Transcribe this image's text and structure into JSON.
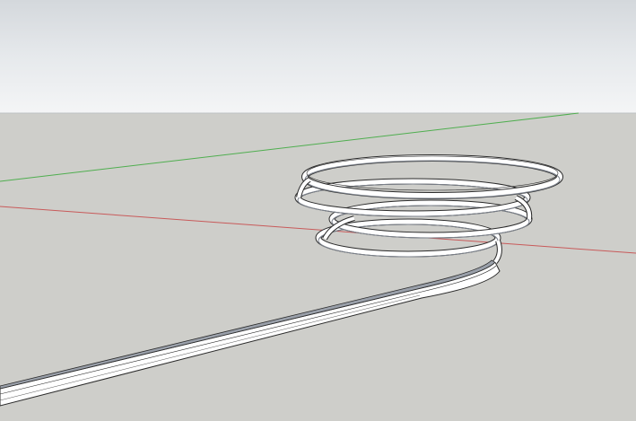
{
  "app": {
    "kind": "3d-modeling-viewport"
  },
  "scene": {
    "sky_color_top": "#d4d8dc",
    "sky_color_bottom": "#f4f5f6",
    "ground_color": "#cececa",
    "axes": {
      "red_axis_color": "#c85a5a",
      "green_axis_color": "#4fae4f"
    },
    "model": {
      "type": "spiral-ramp",
      "face_color": "#ffffff",
      "edge_color": "#2a2a2a",
      "shade_color": "#8a8f9a"
    }
  }
}
